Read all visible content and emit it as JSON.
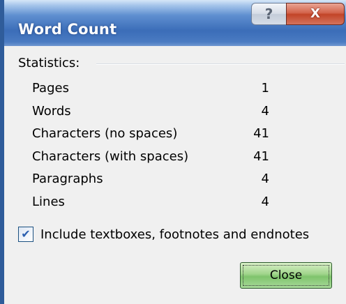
{
  "window": {
    "title": "Word Count",
    "help_glyph": "?",
    "close_glyph": "X"
  },
  "group": {
    "label": "Statistics:"
  },
  "stats": [
    {
      "label": "Pages",
      "value": "1"
    },
    {
      "label": "Words",
      "value": "4"
    },
    {
      "label": "Characters (no spaces)",
      "value": "41"
    },
    {
      "label": "Characters (with spaces)",
      "value": "41"
    },
    {
      "label": "Paragraphs",
      "value": "4"
    },
    {
      "label": "Lines",
      "value": "4"
    }
  ],
  "checkbox": {
    "label": "Include textboxes, footnotes and endnotes",
    "checked": true
  },
  "buttons": {
    "close_label": "Close"
  },
  "icons": {
    "help": "help-question-icon",
    "close": "close-x-icon",
    "check": "checkmark-icon"
  },
  "colors": {
    "titlebar": "#3b6db8",
    "close_x": "#c24428",
    "close_button": "#7fc46c",
    "dialog_bg": "#f0f0f0"
  }
}
